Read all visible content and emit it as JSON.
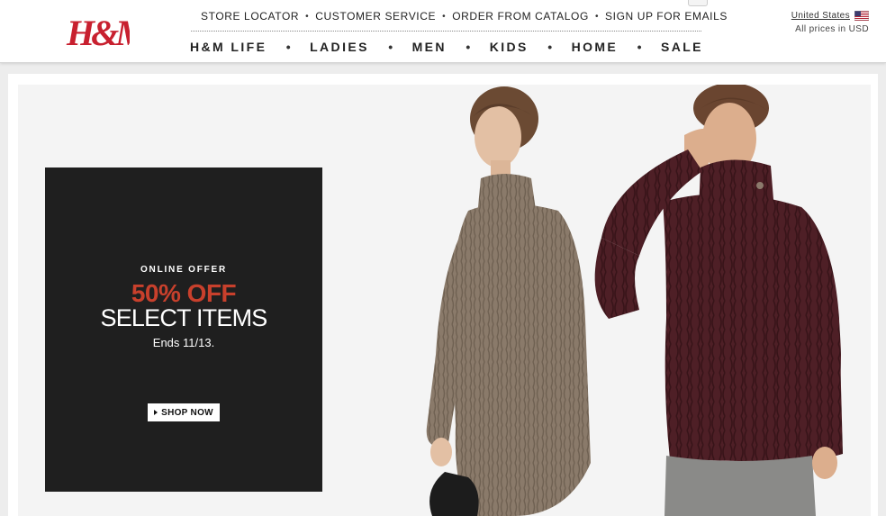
{
  "header": {
    "logo_text": "H&M",
    "util_links": [
      "STORE LOCATOR",
      "CUSTOMER SERVICE",
      "ORDER FROM CATALOG",
      "SIGN UP FOR EMAILS"
    ],
    "main_nav": [
      "H&M LIFE",
      "LADIES",
      "MEN",
      "KIDS",
      "HOME",
      "SALE"
    ],
    "locale": {
      "country": "United States",
      "prices": "All prices in USD"
    }
  },
  "promo": {
    "kicker": "ONLINE OFFER",
    "offer": "50% OFF",
    "items": "SELECT ITEMS",
    "ends": "Ends 11/13.",
    "cta": "SHOP NOW"
  },
  "colors": {
    "logo_red": "#c8202f",
    "offer_red": "#c8402c",
    "promo_bg": "#1f1f1f",
    "womens_sweater": "#8a7a6a",
    "mens_sweater": "#4e1f26"
  },
  "icons": [
    "us-flag-icon",
    "play-arrow-icon"
  ]
}
